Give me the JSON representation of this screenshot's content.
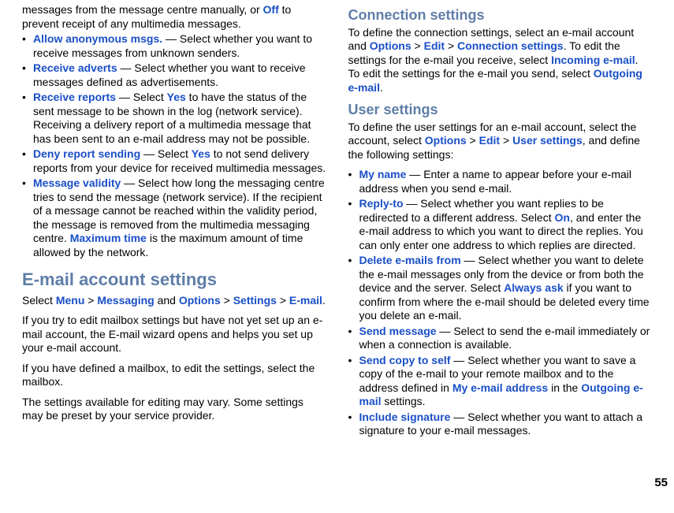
{
  "page_number": "55",
  "left": {
    "intro_tail": {
      "pre": "messages from the message centre manually, or ",
      "off": "Off",
      "post": " to prevent receipt of any multimedia messages."
    },
    "items": [
      {
        "term": "Allow anonymous msgs.",
        "body": " — Select whether you want to receive messages from unknown senders."
      },
      {
        "term": "Receive adverts",
        "body": " — Select whether you want to receive messages defined as advertisements."
      },
      {
        "term": "Receive reports",
        "pre": " — Select ",
        "val": "Yes",
        "post": " to have the status of the sent message to be shown in the log (network service). Receiving a delivery report of a multimedia message that has been sent to an e-mail address may not be possible."
      },
      {
        "term": "Deny report sending",
        "pre": " — Select ",
        "val": "Yes",
        "post": " to not send delivery reports from your device for received multimedia messages."
      },
      {
        "term": "Message validity",
        "pre": " — Select how long the messaging centre tries to send the message (network service). If the recipient of a message cannot be reached within the validity period, the message is removed from the multimedia messaging centre. ",
        "val": "Maximum time",
        "post": " is the maximum amount of time allowed by the network."
      }
    ],
    "heading": "E-mail account settings",
    "nav": {
      "pre": "Select ",
      "s1": "Menu",
      "g1": " > ",
      "s2": "Messaging",
      "mid": " and ",
      "s3": "Options",
      "g2": " > ",
      "s4": "Settings",
      "g3": " > ",
      "s5": "E-mail",
      "end": "."
    },
    "p1": "If you try to edit mailbox settings but have not yet set up an e-mail account, the E-mail wizard opens and helps you set up your e-mail account.",
    "p2": "If you have defined a mailbox, to edit the settings, select the mailbox.",
    "p3": "The settings available for editing may vary. Some settings may be preset by your service provider."
  },
  "right": {
    "h_conn": "Connection settings",
    "conn": {
      "pre": "To define the connection settings, select an e-mail account and ",
      "s1": "Options",
      "g1": " > ",
      "s2": "Edit",
      "g2": " > ",
      "s3": "Connection settings",
      "mid": ". To edit the settings for the e-mail you receive, select ",
      "s4": "Incoming e-mail",
      "mid2": ". To edit the settings for the e-mail you send, select ",
      "s5": "Outgoing e-mail",
      "end": "."
    },
    "h_user": "User settings",
    "user_intro": {
      "pre": "To define the user settings for an e-mail account, select the account, select ",
      "s1": "Options",
      "g1": " > ",
      "s2": "Edit",
      "g2": " > ",
      "s3": "User settings",
      "end": ", and define the following settings:"
    },
    "items": [
      {
        "term": "My name",
        "body": " — Enter a name to appear before your e-mail address when you send e-mail."
      },
      {
        "term": "Reply-to",
        "pre": " — Select whether you want replies to be redirected to a different address. Select ",
        "val": "On",
        "post": ", and enter the e-mail address to which you want to direct the replies. You can only enter one address to which replies are directed."
      },
      {
        "term": "Delete e-mails from",
        "pre": " — Select whether you want to delete the e-mail messages only from the device or from both the device and the server. Select ",
        "val": "Always ask",
        "post": " if you want to confirm from where the e-mail should be deleted every time you delete an e-mail."
      },
      {
        "term": "Send message",
        "body": " — Select to send the e-mail immediately or when a connection is available."
      },
      {
        "term": "Send copy to self",
        "pre": " — Select whether you want to save a copy of the e-mail to your remote mailbox and to the address defined in ",
        "val": "My e-mail address",
        "mid": " in the ",
        "val2": "Outgoing e-mail",
        "post": " settings."
      },
      {
        "term": "Include signature",
        "body": " — Select whether you want to attach a signature to your e-mail messages."
      }
    ]
  }
}
